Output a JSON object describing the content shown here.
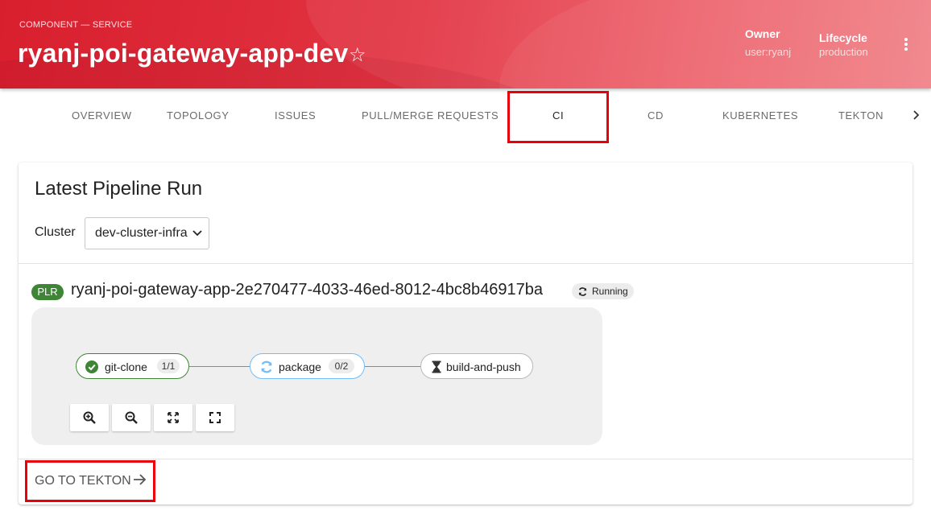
{
  "header": {
    "kind": "COMPONENT — SERVICE",
    "title": "ryanj-poi-gateway-app-dev",
    "favorite_icon": "star-outline-icon",
    "owner_label": "Owner",
    "owner_value": "user:ryanj",
    "lifecycle_label": "Lifecycle",
    "lifecycle_value": "production",
    "menu_icon": "more-vertical-icon",
    "gradient_colors": [
      "#d81f2e",
      "#f07a80"
    ]
  },
  "tabs": {
    "items": [
      {
        "label": "OVERVIEW"
      },
      {
        "label": "TOPOLOGY"
      },
      {
        "label": "ISSUES"
      },
      {
        "label": "PULL/MERGE REQUESTS"
      },
      {
        "label": "CI",
        "active": true
      },
      {
        "label": "CD"
      },
      {
        "label": "KUBERNETES"
      },
      {
        "label": "TEKTON"
      }
    ],
    "scroll_icon": "chevron-right-icon",
    "active_indicator_color": "#1f5aa6"
  },
  "card": {
    "title": "Latest Pipeline Run",
    "cluster_label": "Cluster",
    "cluster_value": "dev-cluster-infra",
    "run": {
      "badge": "PLR",
      "badge_color": "#3e8635",
      "name": "ryanj-poi-gateway-app-2e270477-4033-46ed-8012-4bc8b46917ba",
      "status": "Running",
      "status_icon": "sync-icon"
    },
    "pipeline": {
      "tasks": [
        {
          "name": "git-clone",
          "count": "1/1",
          "status": "succeeded",
          "icon": "check-circle-icon",
          "color": "#3e8635"
        },
        {
          "name": "package",
          "count": "0/2",
          "status": "running",
          "icon": "sync-icon",
          "color": "#73bcf7"
        },
        {
          "name": "build-and-push",
          "count": "",
          "status": "pending",
          "icon": "hourglass-icon",
          "color": "#b8b8b8"
        }
      ],
      "controls": [
        "zoom-in-icon",
        "zoom-out-icon",
        "fit-to-screen-icon",
        "expand-icon"
      ]
    },
    "footer_link": "GO TO TEKTON",
    "footer_icon": "arrow-right-icon"
  },
  "highlight_color": "#e8000b"
}
